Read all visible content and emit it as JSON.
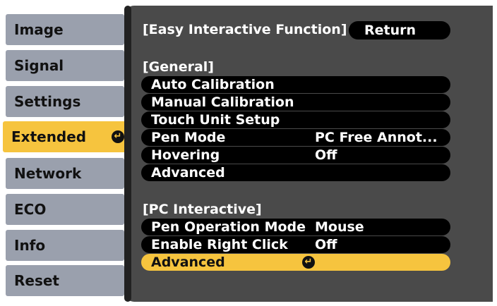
{
  "sidebar": {
    "items": [
      {
        "label": "Image"
      },
      {
        "label": "Signal"
      },
      {
        "label": "Settings"
      },
      {
        "label": "Extended"
      },
      {
        "label": "Network"
      },
      {
        "label": "ECO"
      },
      {
        "label": "Info"
      },
      {
        "label": "Reset"
      }
    ],
    "active_index": 3,
    "enter_symbol": "↵"
  },
  "panel": {
    "title": "[Easy Interactive Function]",
    "return_label": "Return",
    "general_header": "[General]",
    "general_items": [
      {
        "label": "Auto Calibration",
        "value": ""
      },
      {
        "label": "Manual Calibration",
        "value": ""
      },
      {
        "label": "Touch Unit Setup",
        "value": ""
      },
      {
        "label": "Pen Mode",
        "value": "PC Free Annot..."
      },
      {
        "label": "Hovering",
        "value": "Off"
      },
      {
        "label": "Advanced",
        "value": ""
      }
    ],
    "pc_header": "[PC Interactive]",
    "pc_items": [
      {
        "label": "Pen Operation Mode",
        "value": "Mouse"
      },
      {
        "label": "Enable Right Click",
        "value": "Off"
      },
      {
        "label": "Advanced",
        "value": ""
      }
    ],
    "selected_pc_index": 2,
    "enter_symbol": "↵"
  },
  "colors": {
    "tab_bg": "#9aa0ad",
    "accent": "#f6c43e",
    "panel_bg": "#4a4a4a",
    "row_bg": "#000000"
  }
}
